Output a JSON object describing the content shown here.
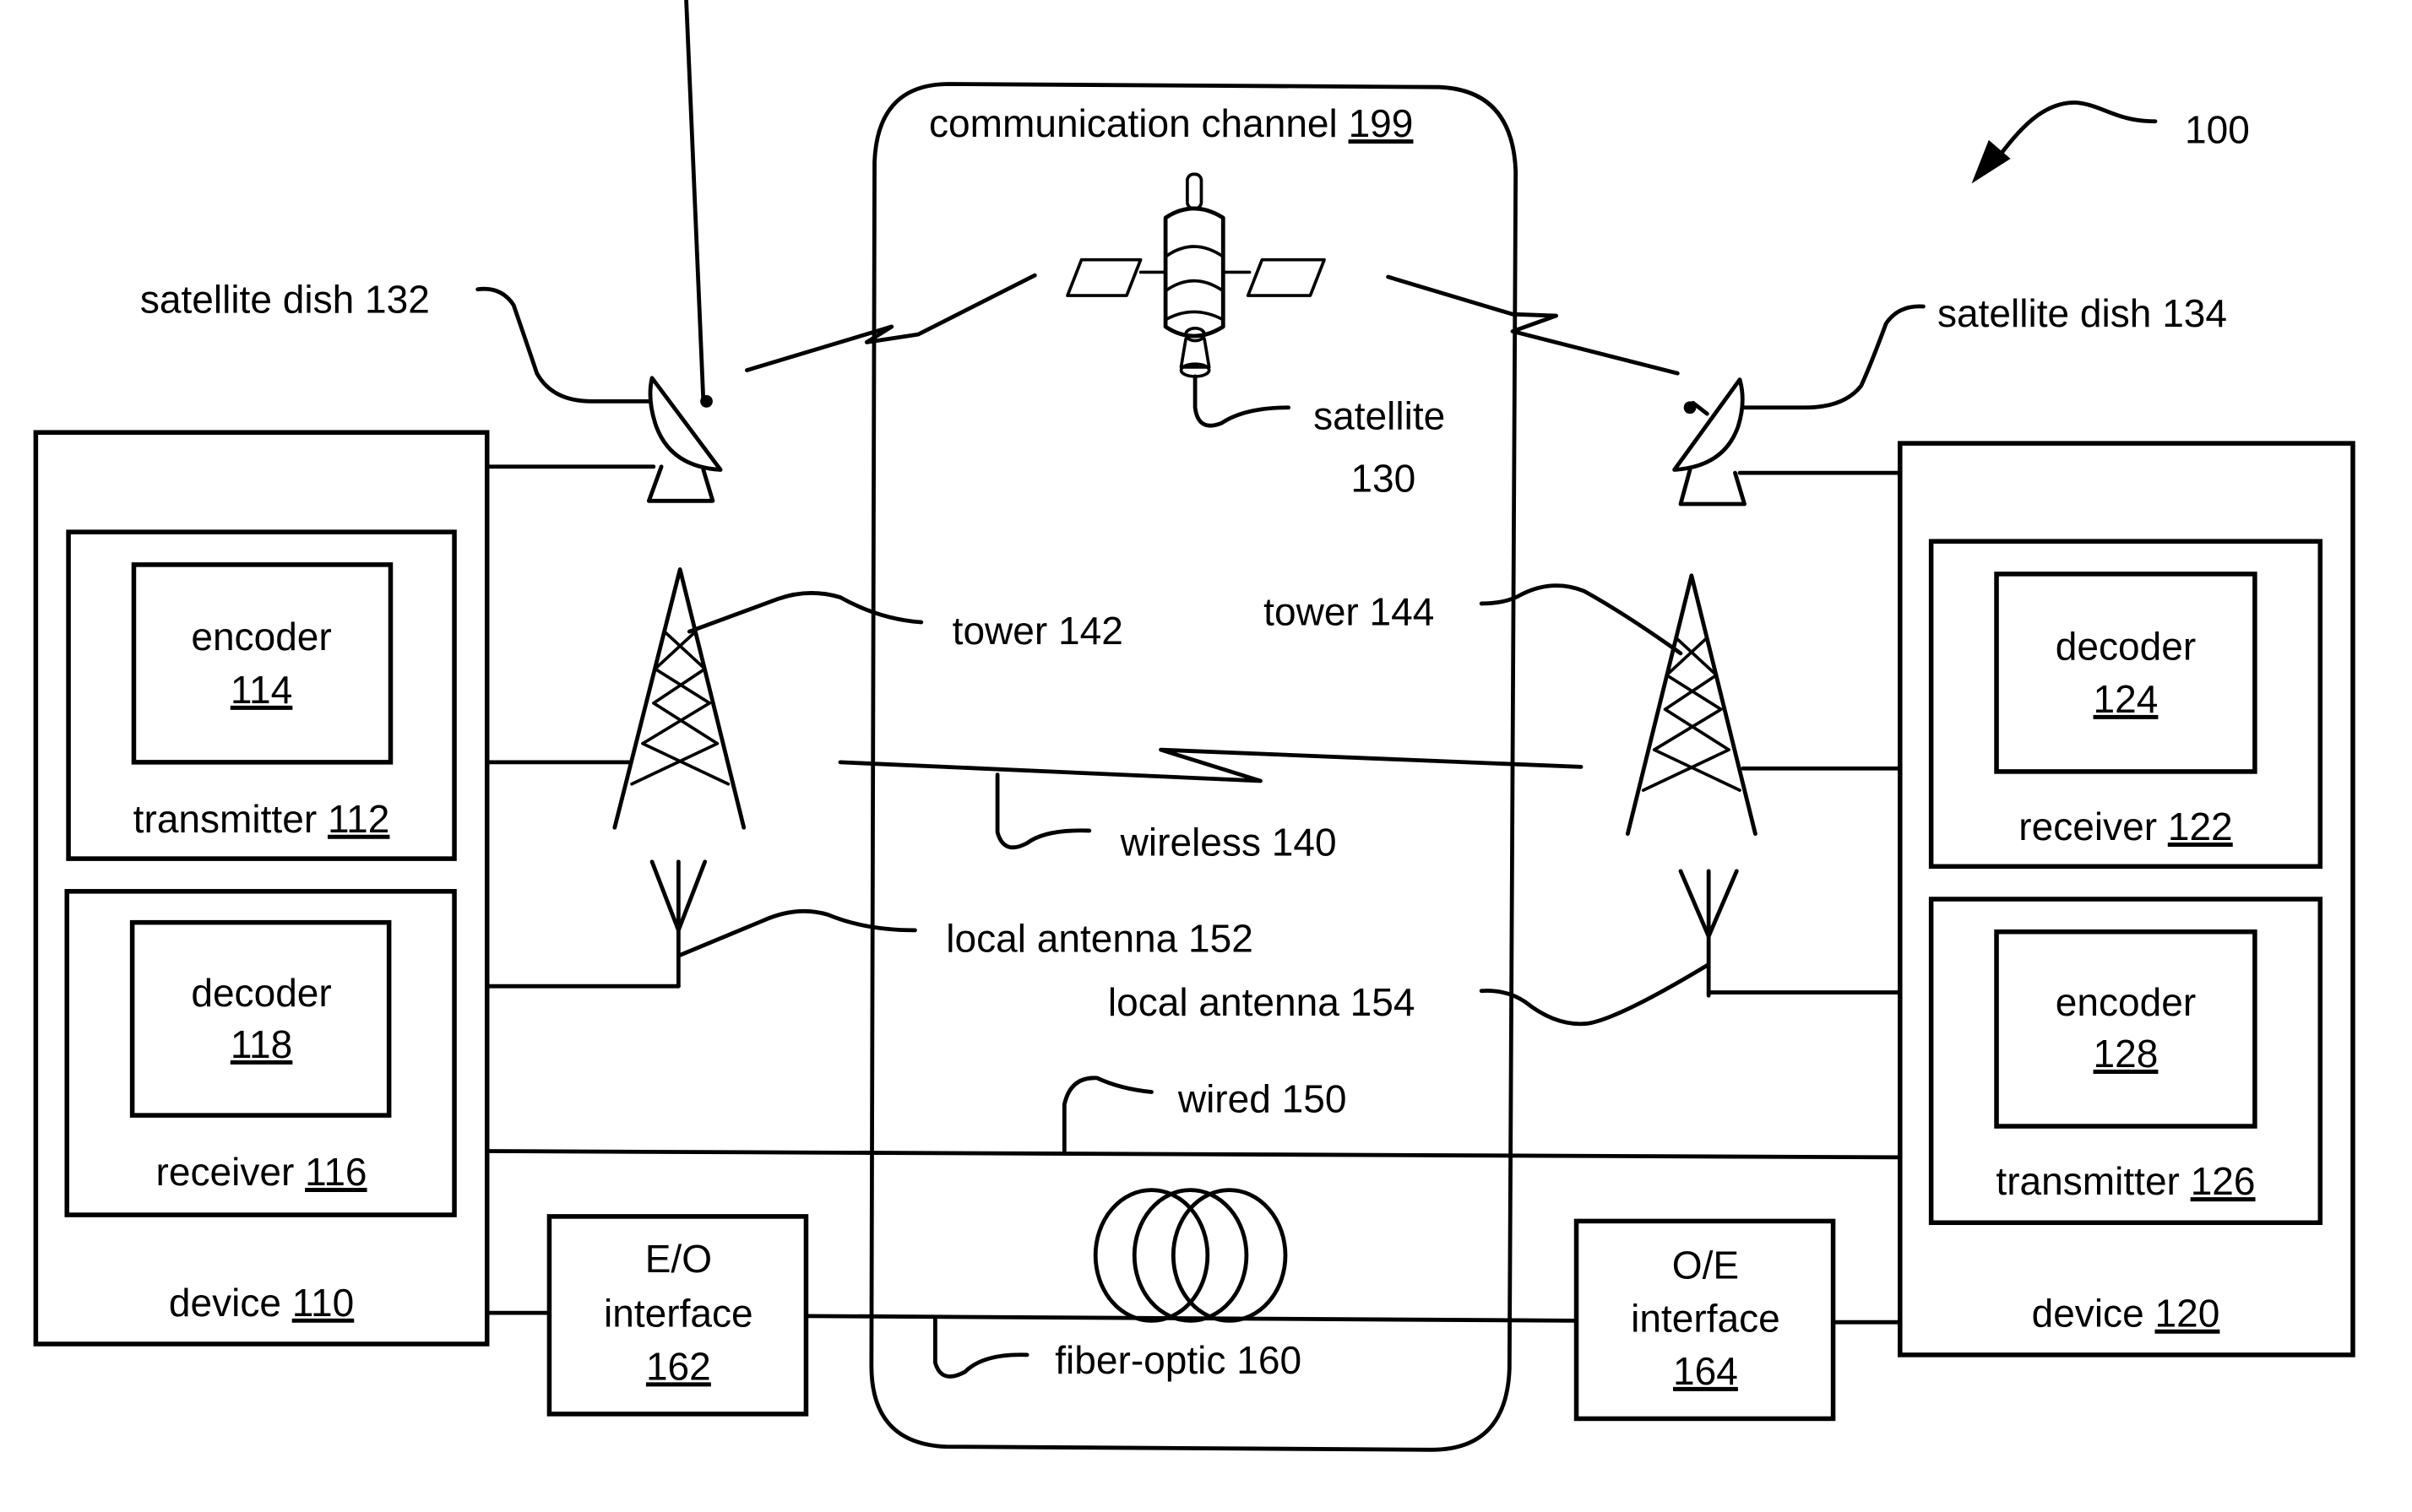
{
  "figure": {
    "ref_number": "100",
    "channel": {
      "label": "communication channel",
      "ref": "199"
    },
    "satellite": {
      "label": "satellite",
      "ref": "130"
    },
    "dish_left": {
      "label": "satellite dish 132"
    },
    "dish_right": {
      "label": "satellite dish 134"
    },
    "tower_left": {
      "label": "tower 142"
    },
    "tower_right": {
      "label": "tower 144"
    },
    "wireless": {
      "label": "wireless 140"
    },
    "antenna_left": {
      "label": "local antenna 152"
    },
    "antenna_right": {
      "label": "local antenna 154"
    },
    "wired": {
      "label": "wired 150"
    },
    "fiber": {
      "label": "fiber-optic 160"
    },
    "eo_interface": {
      "line1": "E/O",
      "line2": "interface",
      "ref": "162"
    },
    "oe_interface": {
      "line1": "O/E",
      "line2": "interface",
      "ref": "164"
    },
    "device_left": {
      "label": "device",
      "ref": "110",
      "transmitter": {
        "label": "transmitter",
        "ref": "112"
      },
      "encoder": {
        "label": "encoder",
        "ref": "114"
      },
      "receiver": {
        "label": "receiver",
        "ref": "116"
      },
      "decoder": {
        "label": "decoder",
        "ref": "118"
      }
    },
    "device_right": {
      "label": "device",
      "ref": "120",
      "receiver": {
        "label": "receiver",
        "ref": "122"
      },
      "decoder": {
        "label": "decoder",
        "ref": "124"
      },
      "transmitter": {
        "label": "transmitter",
        "ref": "126"
      },
      "encoder": {
        "label": "encoder",
        "ref": "128"
      }
    }
  }
}
